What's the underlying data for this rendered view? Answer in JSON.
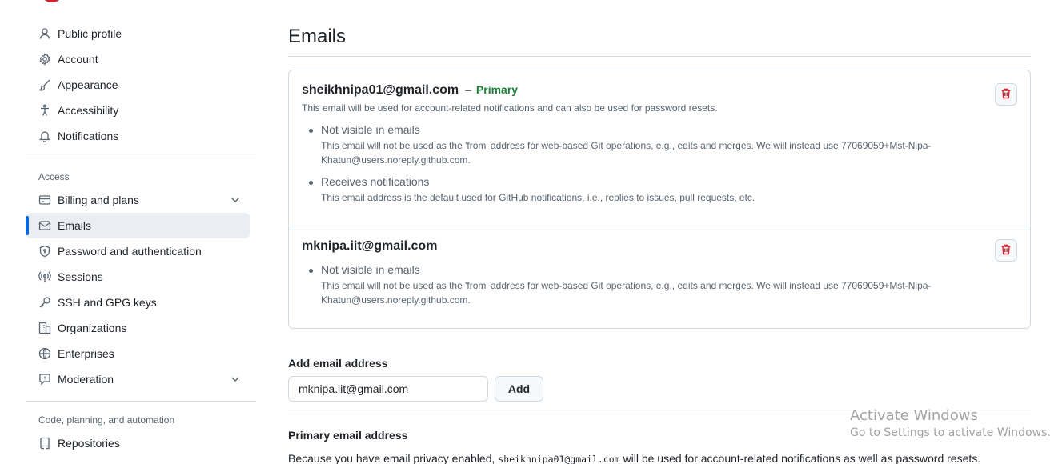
{
  "sidebar": {
    "group1": [
      {
        "label": "Public profile",
        "icon": "person-icon"
      },
      {
        "label": "Account",
        "icon": "gear-icon"
      },
      {
        "label": "Appearance",
        "icon": "paintbrush-icon"
      },
      {
        "label": "Accessibility",
        "icon": "accessibility-icon"
      },
      {
        "label": "Notifications",
        "icon": "bell-icon"
      }
    ],
    "access_heading": "Access",
    "group2": [
      {
        "label": "Billing and plans",
        "icon": "credit-card-icon",
        "expandable": true
      },
      {
        "label": "Emails",
        "icon": "mail-icon",
        "active": true
      },
      {
        "label": "Password and authentication",
        "icon": "shield-lock-icon"
      },
      {
        "label": "Sessions",
        "icon": "broadcast-icon"
      },
      {
        "label": "SSH and GPG keys",
        "icon": "key-icon"
      },
      {
        "label": "Organizations",
        "icon": "organization-icon"
      },
      {
        "label": "Enterprises",
        "icon": "globe-icon"
      },
      {
        "label": "Moderation",
        "icon": "report-icon",
        "expandable": true
      }
    ],
    "code_heading": "Code, planning, and automation",
    "group3": [
      {
        "label": "Repositories",
        "icon": "repo-icon"
      }
    ]
  },
  "main": {
    "title": "Emails",
    "emails": [
      {
        "address": "sheikhnipa01@gmail.com",
        "dash": "–",
        "primary_label": "Primary",
        "description": "This email will be used for account-related notifications and can also be used for password resets.",
        "items": [
          {
            "title": "Not visible in emails",
            "desc": "This email will not be used as the 'from' address for web-based Git operations, e.g., edits and merges. We will instead use 77069059+Mst-Nipa-Khatun@users.noreply.github.com."
          },
          {
            "title": "Receives notifications",
            "desc": "This email address is the default used for GitHub notifications, i.e., replies to issues, pull requests, etc."
          }
        ]
      },
      {
        "address": "mknipa.iit@gmail.com",
        "items": [
          {
            "title": "Not visible in emails",
            "desc": "This email will not be used as the 'from' address for web-based Git operations, e.g., edits and merges. We will instead use 77069059+Mst-Nipa-Khatun@users.noreply.github.com."
          }
        ]
      }
    ],
    "add_email": {
      "label": "Add email address",
      "value": "mknipa.iit@gmail.com",
      "button": "Add"
    },
    "primary_section": {
      "heading": "Primary email address",
      "text_before": "Because you have email privacy enabled, ",
      "code": "sheikhnipa01@gmail.com",
      "text_after": " will be used for account-related notifications as well as password resets."
    }
  },
  "watermark": {
    "title": "Activate Windows",
    "subtitle": "Go to Settings to activate Windows."
  },
  "colors": {
    "accent": "#0969da",
    "primary_green": "#1a7f37",
    "danger": "#d1242f"
  }
}
